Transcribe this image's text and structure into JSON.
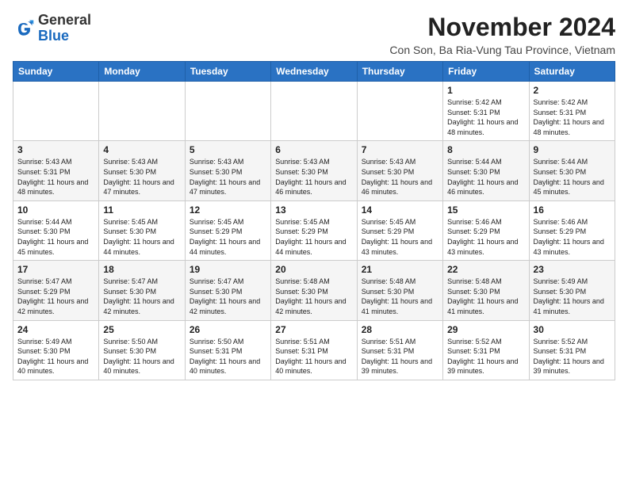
{
  "logo": {
    "general": "General",
    "blue": "Blue"
  },
  "header": {
    "month_title": "November 2024",
    "subtitle": "Con Son, Ba Ria-Vung Tau Province, Vietnam"
  },
  "days_of_week": [
    "Sunday",
    "Monday",
    "Tuesday",
    "Wednesday",
    "Thursday",
    "Friday",
    "Saturday"
  ],
  "weeks": [
    [
      {
        "day": "",
        "info": ""
      },
      {
        "day": "",
        "info": ""
      },
      {
        "day": "",
        "info": ""
      },
      {
        "day": "",
        "info": ""
      },
      {
        "day": "",
        "info": ""
      },
      {
        "day": "1",
        "info": "Sunrise: 5:42 AM\nSunset: 5:31 PM\nDaylight: 11 hours and 48 minutes."
      },
      {
        "day": "2",
        "info": "Sunrise: 5:42 AM\nSunset: 5:31 PM\nDaylight: 11 hours and 48 minutes."
      }
    ],
    [
      {
        "day": "3",
        "info": "Sunrise: 5:43 AM\nSunset: 5:31 PM\nDaylight: 11 hours and 48 minutes."
      },
      {
        "day": "4",
        "info": "Sunrise: 5:43 AM\nSunset: 5:30 PM\nDaylight: 11 hours and 47 minutes."
      },
      {
        "day": "5",
        "info": "Sunrise: 5:43 AM\nSunset: 5:30 PM\nDaylight: 11 hours and 47 minutes."
      },
      {
        "day": "6",
        "info": "Sunrise: 5:43 AM\nSunset: 5:30 PM\nDaylight: 11 hours and 46 minutes."
      },
      {
        "day": "7",
        "info": "Sunrise: 5:43 AM\nSunset: 5:30 PM\nDaylight: 11 hours and 46 minutes."
      },
      {
        "day": "8",
        "info": "Sunrise: 5:44 AM\nSunset: 5:30 PM\nDaylight: 11 hours and 46 minutes."
      },
      {
        "day": "9",
        "info": "Sunrise: 5:44 AM\nSunset: 5:30 PM\nDaylight: 11 hours and 45 minutes."
      }
    ],
    [
      {
        "day": "10",
        "info": "Sunrise: 5:44 AM\nSunset: 5:30 PM\nDaylight: 11 hours and 45 minutes."
      },
      {
        "day": "11",
        "info": "Sunrise: 5:45 AM\nSunset: 5:30 PM\nDaylight: 11 hours and 44 minutes."
      },
      {
        "day": "12",
        "info": "Sunrise: 5:45 AM\nSunset: 5:29 PM\nDaylight: 11 hours and 44 minutes."
      },
      {
        "day": "13",
        "info": "Sunrise: 5:45 AM\nSunset: 5:29 PM\nDaylight: 11 hours and 44 minutes."
      },
      {
        "day": "14",
        "info": "Sunrise: 5:45 AM\nSunset: 5:29 PM\nDaylight: 11 hours and 43 minutes."
      },
      {
        "day": "15",
        "info": "Sunrise: 5:46 AM\nSunset: 5:29 PM\nDaylight: 11 hours and 43 minutes."
      },
      {
        "day": "16",
        "info": "Sunrise: 5:46 AM\nSunset: 5:29 PM\nDaylight: 11 hours and 43 minutes."
      }
    ],
    [
      {
        "day": "17",
        "info": "Sunrise: 5:47 AM\nSunset: 5:29 PM\nDaylight: 11 hours and 42 minutes."
      },
      {
        "day": "18",
        "info": "Sunrise: 5:47 AM\nSunset: 5:30 PM\nDaylight: 11 hours and 42 minutes."
      },
      {
        "day": "19",
        "info": "Sunrise: 5:47 AM\nSunset: 5:30 PM\nDaylight: 11 hours and 42 minutes."
      },
      {
        "day": "20",
        "info": "Sunrise: 5:48 AM\nSunset: 5:30 PM\nDaylight: 11 hours and 42 minutes."
      },
      {
        "day": "21",
        "info": "Sunrise: 5:48 AM\nSunset: 5:30 PM\nDaylight: 11 hours and 41 minutes."
      },
      {
        "day": "22",
        "info": "Sunrise: 5:48 AM\nSunset: 5:30 PM\nDaylight: 11 hours and 41 minutes."
      },
      {
        "day": "23",
        "info": "Sunrise: 5:49 AM\nSunset: 5:30 PM\nDaylight: 11 hours and 41 minutes."
      }
    ],
    [
      {
        "day": "24",
        "info": "Sunrise: 5:49 AM\nSunset: 5:30 PM\nDaylight: 11 hours and 40 minutes."
      },
      {
        "day": "25",
        "info": "Sunrise: 5:50 AM\nSunset: 5:30 PM\nDaylight: 11 hours and 40 minutes."
      },
      {
        "day": "26",
        "info": "Sunrise: 5:50 AM\nSunset: 5:31 PM\nDaylight: 11 hours and 40 minutes."
      },
      {
        "day": "27",
        "info": "Sunrise: 5:51 AM\nSunset: 5:31 PM\nDaylight: 11 hours and 40 minutes."
      },
      {
        "day": "28",
        "info": "Sunrise: 5:51 AM\nSunset: 5:31 PM\nDaylight: 11 hours and 39 minutes."
      },
      {
        "day": "29",
        "info": "Sunrise: 5:52 AM\nSunset: 5:31 PM\nDaylight: 11 hours and 39 minutes."
      },
      {
        "day": "30",
        "info": "Sunrise: 5:52 AM\nSunset: 5:31 PM\nDaylight: 11 hours and 39 minutes."
      }
    ]
  ]
}
